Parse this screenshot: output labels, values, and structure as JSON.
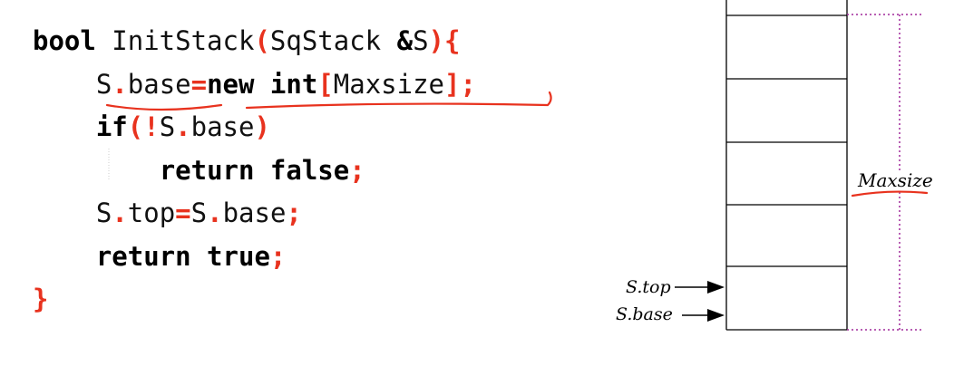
{
  "code": {
    "lines": [
      {
        "indent": 0,
        "tokens": [
          {
            "t": "bool",
            "c": "kw"
          },
          {
            "t": " InitStack",
            "c": ""
          },
          {
            "t": "(",
            "c": "red"
          },
          {
            "t": "SqStack ",
            "c": ""
          },
          {
            "t": "&",
            "c": "kw"
          },
          {
            "t": "S",
            "c": ""
          },
          {
            "t": ")",
            "c": "red"
          },
          {
            "t": "{",
            "c": "red"
          }
        ]
      },
      {
        "indent": 4,
        "tokens": [
          {
            "t": "S",
            "c": ""
          },
          {
            "t": ".",
            "c": "red"
          },
          {
            "t": "base",
            "c": ""
          },
          {
            "t": "=",
            "c": "red"
          },
          {
            "t": "new int",
            "c": "kw"
          },
          {
            "t": "[",
            "c": "red"
          },
          {
            "t": "Maxsize",
            "c": ""
          },
          {
            "t": "]",
            "c": "red"
          },
          {
            "t": ";",
            "c": "red"
          }
        ]
      },
      {
        "indent": 4,
        "tokens": [
          {
            "t": "if",
            "c": "kw"
          },
          {
            "t": "(",
            "c": "red"
          },
          {
            "t": "!",
            "c": "red"
          },
          {
            "t": "S",
            "c": ""
          },
          {
            "t": ".",
            "c": "red"
          },
          {
            "t": "base",
            "c": ""
          },
          {
            "t": ")",
            "c": "red"
          }
        ]
      },
      {
        "indent": 8,
        "tokens": [
          {
            "t": "return false",
            "c": "kw"
          },
          {
            "t": ";",
            "c": "red"
          }
        ]
      },
      {
        "indent": 4,
        "tokens": [
          {
            "t": "S",
            "c": ""
          },
          {
            "t": ".",
            "c": "red"
          },
          {
            "t": "top",
            "c": ""
          },
          {
            "t": "=",
            "c": "red"
          },
          {
            "t": "S",
            "c": ""
          },
          {
            "t": ".",
            "c": "red"
          },
          {
            "t": "base",
            "c": ""
          },
          {
            "t": ";",
            "c": "red"
          }
        ]
      },
      {
        "indent": 4,
        "tokens": [
          {
            "t": "return true",
            "c": "kw"
          },
          {
            "t": ";",
            "c": "red"
          }
        ]
      },
      {
        "indent": 0,
        "tokens": [
          {
            "t": "}",
            "c": "red"
          }
        ]
      }
    ]
  },
  "diagram": {
    "labels": {
      "maxsize": "Maxsize",
      "top": "S.top",
      "base": "S.base"
    },
    "colors": {
      "ink": "#000000",
      "dotted": "#a0289a",
      "annotation": "#e8321e"
    }
  }
}
